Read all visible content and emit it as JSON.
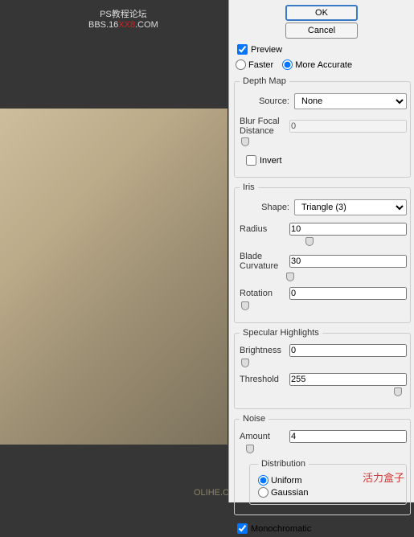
{
  "watermark": {
    "line1": "PS教程论坛",
    "line2a": "BBS.16",
    "line2b": "XX8",
    "line2c": ".COM"
  },
  "olihe": "OLIHE.C",
  "buttons": {
    "ok": "OK",
    "cancel": "Cancel"
  },
  "preview": {
    "label": "Preview",
    "checked": true
  },
  "quality": {
    "faster": "Faster",
    "accurate": "More Accurate"
  },
  "depthMap": {
    "legend": "Depth Map",
    "sourceLabel": "Source:",
    "sourceValue": "None",
    "blurFocalLabel": "Blur Focal Distance",
    "blurFocalValue": "0",
    "invertLabel": "Invert",
    "invertChecked": false
  },
  "iris": {
    "legend": "Iris",
    "shapeLabel": "Shape:",
    "shapeValue": "Triangle (3)",
    "radiusLabel": "Radius",
    "radiusValue": "10",
    "bladeLabel": "Blade Curvature",
    "bladeValue": "30",
    "rotationLabel": "Rotation",
    "rotationValue": "0"
  },
  "specular": {
    "legend": "Specular Highlights",
    "brightnessLabel": "Brightness",
    "brightnessValue": "0",
    "thresholdLabel": "Threshold",
    "thresholdValue": "255"
  },
  "noise": {
    "legend": "Noise",
    "amountLabel": "Amount",
    "amountValue": "4",
    "distLegend": "Distribution",
    "uniform": "Uniform",
    "gaussian": "Gaussian"
  },
  "mono": {
    "label": "Monochromatic",
    "checked": true
  },
  "brand": "活力盒子"
}
